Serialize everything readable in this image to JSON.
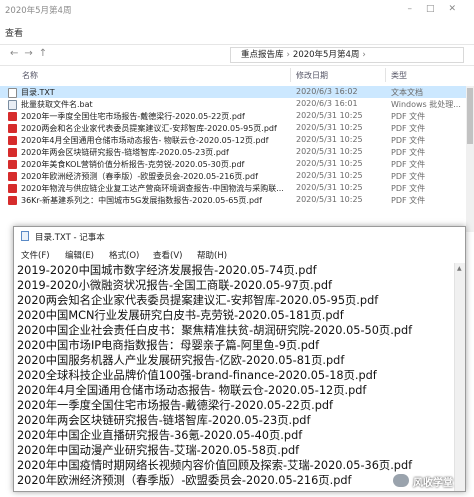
{
  "explorer": {
    "title": "2020年5月第4周",
    "ribbon_tab": "查看",
    "breadcrumb": [
      "重点报告库",
      "2020年5月第4周"
    ],
    "columns": {
      "name": "名称",
      "date": "修改日期",
      "type": "类型"
    },
    "files": [
      {
        "name": "目录.TXT",
        "date": "2020/6/3 16:02",
        "type": "文本文档",
        "icon": "txt-file-icon",
        "selected": true
      },
      {
        "name": "批量获取文件名.bat",
        "date": "2020/6/3 16:01",
        "type": "Windows 批处理...",
        "icon": "bat-file-icon"
      },
      {
        "name": "2020年一季度全国住宅市场报告-戴德梁行-2020.05-22页.pdf",
        "date": "2020/5/31 10:25",
        "type": "PDF 文件",
        "icon": "pdf-file-icon"
      },
      {
        "name": "2020两会和名企业家代表委员提案建议汇-安邦智库-2020.05-95页.pdf",
        "date": "2020/5/31 10:25",
        "type": "PDF 文件",
        "icon": "pdf-file-icon"
      },
      {
        "name": "2020年4月全国通用仓储市场动态报告- 物联云仓-2020.05-12页.pdf",
        "date": "2020/5/31 10:25",
        "type": "PDF 文件",
        "icon": "pdf-file-icon"
      },
      {
        "name": "2020年两会区块链研究报告-链塔智库-2020.05-23页.pdf",
        "date": "2020/5/31 10:25",
        "type": "PDF 文件",
        "icon": "pdf-file-icon"
      },
      {
        "name": "2020年美食KOL营销价值分析报告-克劳锐-2020.05-30页.pdf",
        "date": "2020/5/31 10:25",
        "type": "PDF 文件",
        "icon": "pdf-file-icon"
      },
      {
        "name": "2020年欧洲经济预测（春季版）-欧盟委员会-2020.05-216页.pdf",
        "date": "2020/5/31 10:25",
        "type": "PDF 文件",
        "icon": "pdf-file-icon"
      },
      {
        "name": "2020年物流与供应链企业复工达产营商环境调查报告-中国物流与采购联...",
        "date": "2020/5/31 10:25",
        "type": "PDF 文件",
        "icon": "pdf-file-icon"
      },
      {
        "name": "36Kr-新基建系列之：中国城市5G发展指数报告-2020.05-65页.pdf",
        "date": "2020/5/31 10:25",
        "type": "PDF 文件",
        "icon": "pdf-file-icon"
      }
    ]
  },
  "notepad": {
    "title": "目录.TXT - 记事本",
    "menu": [
      "文件(F)",
      "编辑(E)",
      "格式(O)",
      "查看(V)",
      "帮助(H)"
    ],
    "lines": [
      "2019-2020中国城市数字经济发展报告-2020.05-74页.pdf",
      "2019-2020小微融资状况报告-全国工商联-2020.05-97页.pdf",
      "2020两会知名企业家代表委员提案建议汇-安邦智库-2020.05-95页.pdf",
      "2020中国MCN行业发展研究白皮书-克劳锐-2020.05-181页.pdf",
      "2020中国企业社会责任白皮书：聚焦精准扶贫-胡润研究院-2020.05-50页.pdf",
      "2020中国市场IP电商指数报告：母婴亲子篇-阿里鱼-9页.pdf",
      "2020中国服务机器人产业发展研究报告-亿欧-2020.05-81页.pdf",
      "2020全球科技企业品牌价值100强-brand-finance-2020.05-18页.pdf",
      "2020年4月全国通用仓储市场动态报告- 物联云仓-2020.05-12页.pdf",
      "2020年一季度全国住宅市场报告-戴德梁行-2020.05-22页.pdf",
      "2020年两会区块链研究报告-链塔智库-2020.05-23页.pdf",
      "2020年中国企业直播研究报告-36氪-2020.05-40页.pdf",
      "2020年中国动漫产业研究报告-艾瑞-2020.05-58页.pdf",
      "2020年中国疫情时期网络长视频内容价值回顾及探索-艾瑞-2020.05-36页.pdf",
      "2020年欧洲经济预测（春季版）-欧盟委员会-2020.05-216页.pdf"
    ]
  },
  "watermark": {
    "text": "风收学堂"
  },
  "colors": {
    "selection": "#cce8ff",
    "pdf_icon": "#d62c2c",
    "text": "#111111"
  }
}
